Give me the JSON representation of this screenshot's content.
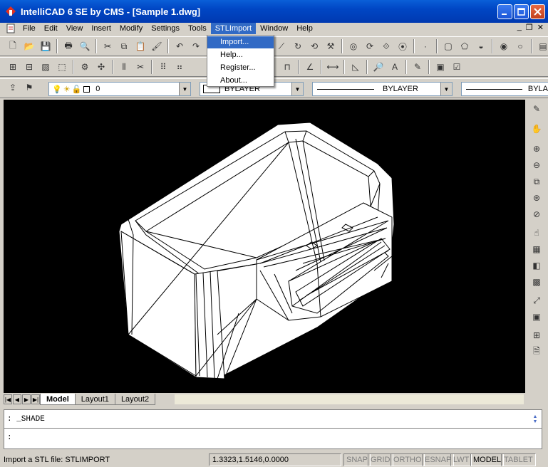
{
  "window": {
    "title": "IntelliCAD 6 SE by CMS - [Sample 1.dwg]",
    "controls": [
      "minimize",
      "maximize",
      "close"
    ]
  },
  "menubar": {
    "items": [
      "File",
      "Edit",
      "View",
      "Insert",
      "Modify",
      "Settings",
      "Tools",
      "STLImport",
      "Window",
      "Help"
    ],
    "active": "STLImport"
  },
  "dropdown": {
    "items": [
      "Import...",
      "Help...",
      "Register...",
      "About..."
    ],
    "highlighted": "Import..."
  },
  "layer_toolbar": {
    "layer_value": "0",
    "color_value": "BYLAYER",
    "linetype_value": "BYLAYER",
    "lineweight_value": "BYLA"
  },
  "layout_tabs": {
    "tabs": [
      "Model",
      "Layout1",
      "Layout2"
    ],
    "active": "Model"
  },
  "command": {
    "line1": ": _SHADE",
    "line2": ":"
  },
  "status": {
    "message": "Import a STL file: STLIMPORT",
    "coordinates": "1.3323,1.5146,0.0000",
    "toggles": [
      "SNAP",
      "GRID",
      "ORTHO",
      "ESNAP",
      "LWT",
      "MODEL",
      "TABLET"
    ],
    "active_toggle": "MODEL"
  },
  "colors": {
    "titlebar": "#0046c4",
    "canvas": "#000000",
    "highlight": "#316ac5",
    "chrome": "#d4d0c8"
  }
}
